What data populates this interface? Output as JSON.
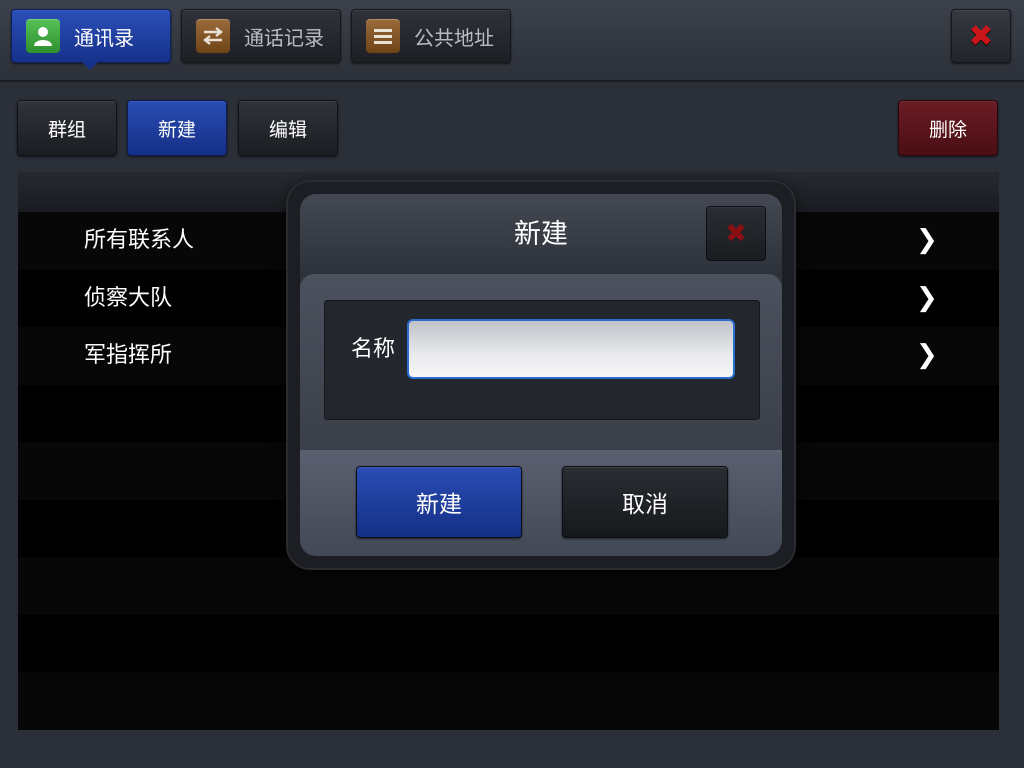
{
  "tabs": [
    {
      "label": "通讯录",
      "icon": "contact-person-icon",
      "active": true,
      "icon_bg": "#3aa43a"
    },
    {
      "label": "通话记录",
      "icon": "swap-arrows-icon",
      "active": false,
      "icon_bg": "#8a5a2a"
    },
    {
      "label": "公共地址",
      "icon": "list-menu-icon",
      "active": false,
      "icon_bg": "#8a5a2a"
    }
  ],
  "close_icon": "✖",
  "toolbar": {
    "group_label": "群组",
    "new_label": "新建",
    "edit_label": "编辑",
    "delete_label": "删除"
  },
  "list": {
    "items": [
      {
        "label": "所有联系人"
      },
      {
        "label": "侦察大队"
      },
      {
        "label": "军指挥所"
      }
    ],
    "chevron": "❯"
  },
  "dialog": {
    "title": "新建",
    "close_icon": "✖",
    "name_label": "名称",
    "name_value": "",
    "confirm_label": "新建",
    "cancel_label": "取消"
  },
  "colors": {
    "accent_blue": "#1f3fa0",
    "danger_red": "#5a141b",
    "close_red": "#c8161a"
  }
}
